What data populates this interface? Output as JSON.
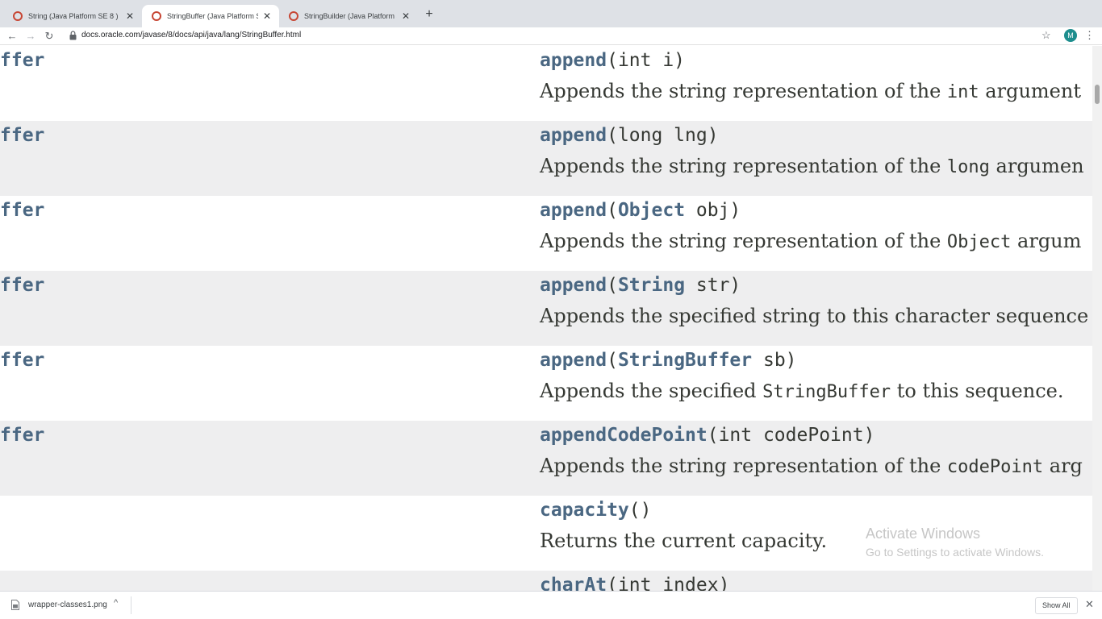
{
  "browser": {
    "tabs": [
      {
        "title": "String (Java Platform SE 8 )"
      },
      {
        "title": "StringBuffer (Java Platform SE 8 )"
      },
      {
        "title": "StringBuilder (Java Platform SE 8 )"
      }
    ],
    "close_glyph": "✕",
    "new_tab_glyph": "+",
    "address": "docs.oracle.com/javase/8/docs/api/java/lang/StringBuffer.html",
    "profile_initial": "M"
  },
  "methods": [
    {
      "left_type": "ffer",
      "name": "append",
      "params": [
        {
          "text": "(int i)"
        }
      ],
      "desc": [
        {
          "t": "Appends the string representation of the "
        },
        {
          "c": "int"
        },
        {
          "t": " argument"
        }
      ]
    },
    {
      "left_type": "ffer",
      "name": "append",
      "params": [
        {
          "text": "(long lng)"
        }
      ],
      "desc": [
        {
          "t": "Appends the string representation of the "
        },
        {
          "c": "long"
        },
        {
          "t": " argumen"
        }
      ]
    },
    {
      "left_type": "ffer",
      "name": "append",
      "params": [
        {
          "text": "("
        },
        {
          "link": "Object"
        },
        {
          "text": " obj)"
        }
      ],
      "desc": [
        {
          "t": "Appends the string representation of the "
        },
        {
          "c": "Object"
        },
        {
          "t": " argum"
        }
      ]
    },
    {
      "left_type": "ffer",
      "name": "append",
      "params": [
        {
          "text": "("
        },
        {
          "link": "String"
        },
        {
          "text": " str)"
        }
      ],
      "desc": [
        {
          "t": "Appends the specified string to this character sequence"
        }
      ]
    },
    {
      "left_type": "ffer",
      "name": "append",
      "params": [
        {
          "text": "("
        },
        {
          "link": "StringBuffer"
        },
        {
          "text": " sb)"
        }
      ],
      "desc": [
        {
          "t": "Appends the specified "
        },
        {
          "c": "StringBuffer"
        },
        {
          "t": " to this sequence."
        }
      ]
    },
    {
      "left_type": "ffer",
      "name": "appendCodePoint",
      "params": [
        {
          "text": "(int codePoint)"
        }
      ],
      "desc": [
        {
          "t": "Appends the string representation of the "
        },
        {
          "c": "codePoint"
        },
        {
          "t": " arg"
        }
      ]
    },
    {
      "left_type": "",
      "name": "capacity",
      "params": [
        {
          "text": "()"
        }
      ],
      "desc": [
        {
          "t": "Returns the current capacity."
        }
      ]
    },
    {
      "left_type": "",
      "name": "charAt",
      "params": [
        {
          "text": "(int index)"
        }
      ],
      "desc": []
    }
  ],
  "watermark": {
    "line1": "Activate Windows",
    "line2": "Go to Settings to activate Windows."
  },
  "download_bar": {
    "file_name": "wrapper-classes1.png",
    "show_all": "Show All",
    "close_glyph": "✕"
  },
  "colors": {
    "link": "#4a6782",
    "text": "#353833",
    "alt_row": "#eeeeef",
    "favicon": "#c74634"
  }
}
